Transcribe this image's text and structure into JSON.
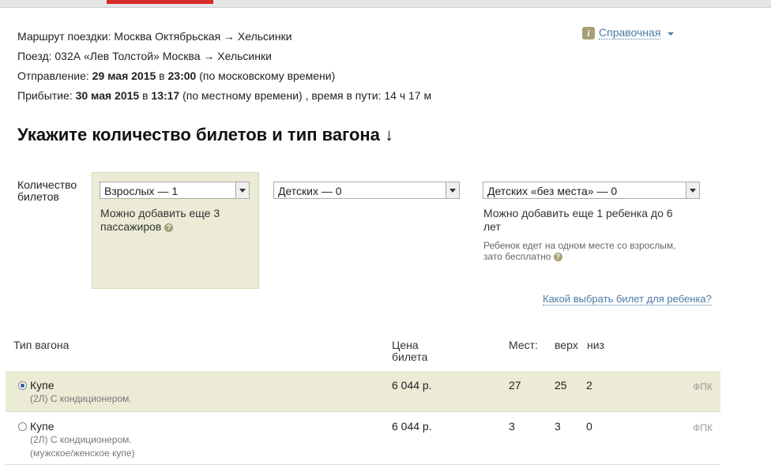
{
  "trip": {
    "route_label": "Маршрут поездки:",
    "route": "Москва Октябрьская → Хельсинки",
    "train_label": "Поезд:",
    "train": "032А «Лев Толстой» Москва → Хельсинки",
    "departure_label": "Отправление:",
    "departure_date": "29 мая 2015",
    "departure_in": "в",
    "departure_time": "23:00",
    "departure_note": "(по московскому времени)",
    "arrival_label": "Прибытие:",
    "arrival_date": "30 мая 2015",
    "arrival_in": "в",
    "arrival_time": "13:17",
    "arrival_note": "(по местному времени) , время в пути: 14 ч 17 м"
  },
  "help": {
    "icon": "info-icon",
    "label": "Справочная"
  },
  "heading": "Укажите количество билетов и тип вагона ↓",
  "tickets": {
    "label_line1": "Количество",
    "label_line2": "билетов",
    "adults_value": "Взрослых — 1",
    "adults_note_1": "Можно добавить еще 3",
    "adults_note_2": "пассажиров",
    "children_value": "Детских — 0",
    "infants_value": "Детских «без места» — 0",
    "infants_note_1": "Можно добавить еще 1 ребенка до 6",
    "infants_note_2": "лет",
    "infants_small_1": "Ребенок едет на одном месте со взрослым,",
    "infants_small_2": "зато бесплатно",
    "help_mark": "?",
    "child_link": "Какой выбрать билет для ребенка?"
  },
  "table": {
    "headers": {
      "type": "Тип вагона",
      "price_1": "Цена",
      "price_2": "билета",
      "seats": "Мест:",
      "upper": "верх",
      "lower": "низ"
    },
    "rows": [
      {
        "selected": true,
        "type": "Купе",
        "sub1": "(2Л) С кондиционером.",
        "sub2": "",
        "price": "6 044 р.",
        "seats": "27",
        "upper": "25",
        "lower": "2",
        "carrier": "ФПК"
      },
      {
        "selected": false,
        "type": "Купе",
        "sub1": "(2Л) С кондиционером.",
        "sub2": "(мужское/женское купе)",
        "price": "6 044 р.",
        "seats": "3",
        "upper": "3",
        "lower": "0",
        "carrier": "ФПК"
      }
    ]
  }
}
